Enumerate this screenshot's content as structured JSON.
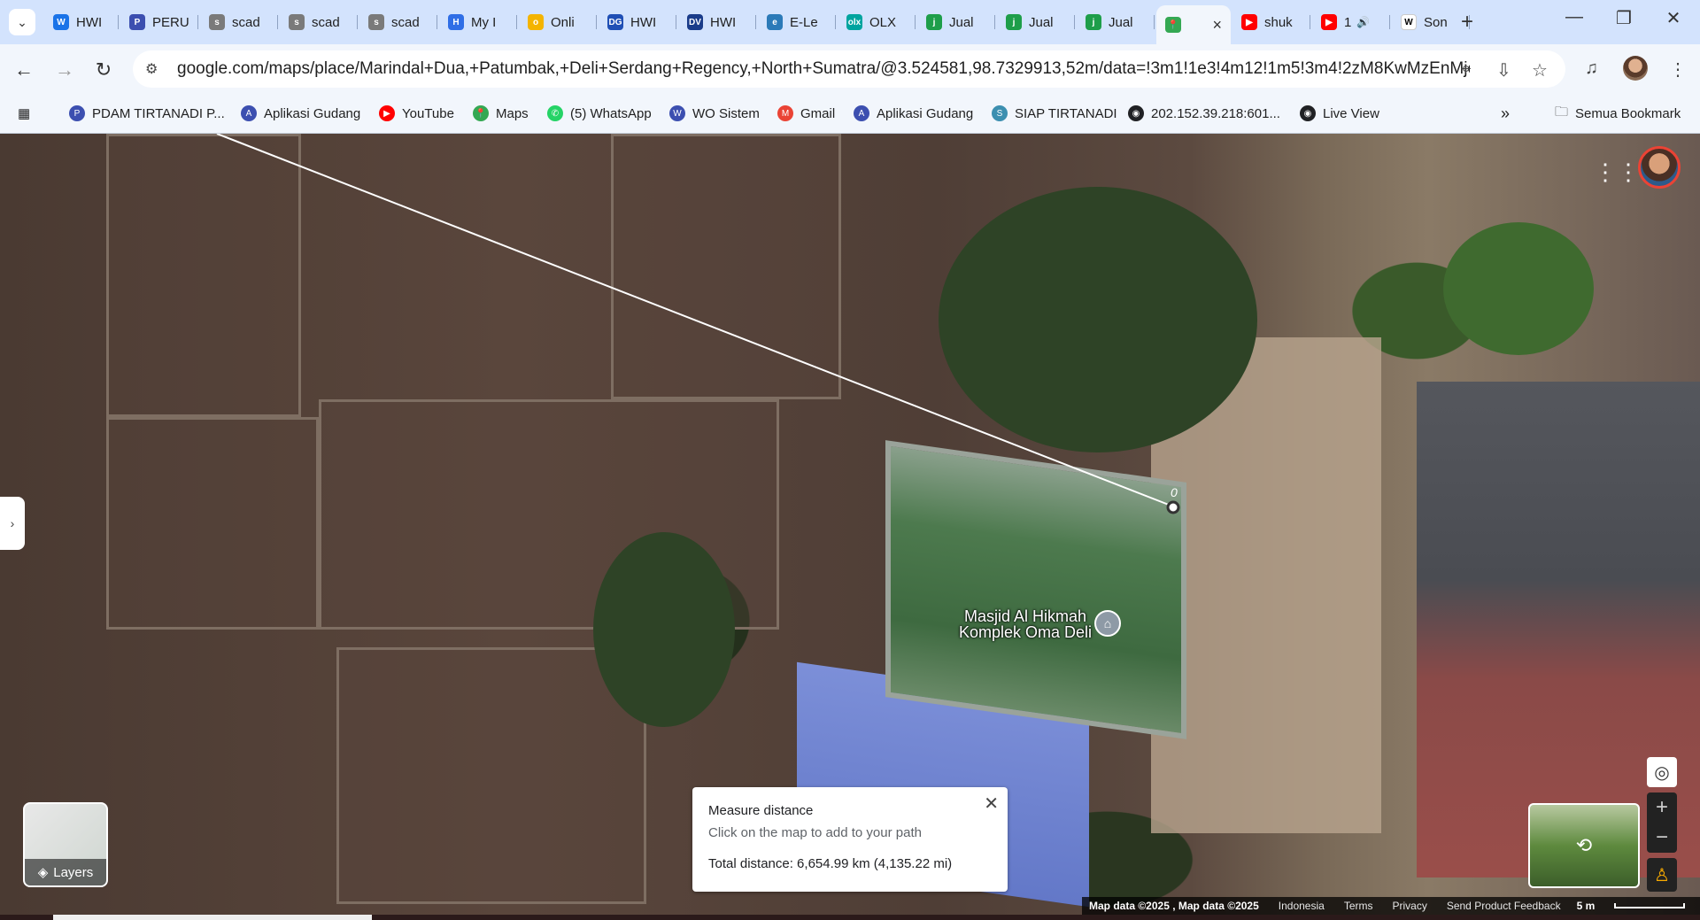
{
  "tabs": [
    {
      "label": "HWI",
      "fav_color": "#1a73e8",
      "fav_glyph": "W"
    },
    {
      "label": "PERU",
      "fav_color": "#3c4fb0",
      "fav_glyph": "P"
    },
    {
      "label": "scad",
      "fav_color": "#7a7a7a",
      "fav_glyph": "s"
    },
    {
      "label": "scad",
      "fav_color": "#7a7a7a",
      "fav_glyph": "s"
    },
    {
      "label": "scad",
      "fav_color": "#7a7a7a",
      "fav_glyph": "s"
    },
    {
      "label": "My I",
      "fav_color": "#2f6ee6",
      "fav_glyph": "H"
    },
    {
      "label": "Onli",
      "fav_color": "#f4b400",
      "fav_glyph": "o"
    },
    {
      "label": "HWI",
      "fav_color": "#1f4fb5",
      "fav_glyph": "DG"
    },
    {
      "label": "HWI",
      "fav_color": "#1a3c8a",
      "fav_glyph": "DV"
    },
    {
      "label": "E-Le",
      "fav_color": "#2b7ab8",
      "fav_glyph": "e"
    },
    {
      "label": "OLX",
      "fav_color": "#00a49f",
      "fav_glyph": "olx"
    },
    {
      "label": "Jual",
      "fav_color": "#1e9e4a",
      "fav_glyph": "j"
    },
    {
      "label": "Jual",
      "fav_color": "#1e9e4a",
      "fav_glyph": "j"
    },
    {
      "label": "Jual",
      "fav_color": "#1e9e4a",
      "fav_glyph": "j"
    },
    {
      "label": "",
      "fav_color": "#34a853",
      "fav_glyph": "📍",
      "active": true
    },
    {
      "label": "shuk",
      "fav_color": "#ff0000",
      "fav_glyph": "▶"
    },
    {
      "label": "1",
      "fav_color": "#ff0000",
      "fav_glyph": "▶",
      "audio": true
    },
    {
      "label": "Son",
      "fav_color": "#ffffff",
      "fav_glyph": "W"
    }
  ],
  "omnibox": {
    "url": "google.com/maps/place/Marindal+Dua,+Patumbak,+Deli+Serdang+Regency,+North+Sumatra/@3.524581,98.7329913,52m/data=!3m1!1e3!4m12!1m5!3m4!2zM8KwMzEnMjcuNCJOID..."
  },
  "bookmarks": [
    {
      "label": "PDAM TIRTANADI P...",
      "color": "#3c4fb0",
      "glyph": "P"
    },
    {
      "label": "Aplikasi Gudang",
      "color": "#3c4fb0",
      "glyph": "A"
    },
    {
      "label": "YouTube",
      "color": "#ff0000",
      "glyph": "▶"
    },
    {
      "label": "Maps",
      "color": "#34a853",
      "glyph": "📍"
    },
    {
      "label": "(5) WhatsApp",
      "color": "#25d366",
      "glyph": "✆"
    },
    {
      "label": "WO Sistem",
      "color": "#3c4fb0",
      "glyph": "W"
    },
    {
      "label": "Gmail",
      "color": "#ea4335",
      "glyph": "M"
    },
    {
      "label": "Aplikasi Gudang",
      "color": "#3c4fb0",
      "glyph": "A"
    },
    {
      "label": "SIAP TIRTANADI",
      "color": "#3c8fb0",
      "glyph": "S"
    },
    {
      "label": "202.152.39.218:601...",
      "color": "#202124",
      "glyph": "◉"
    },
    {
      "label": "Live View",
      "color": "#202124",
      "glyph": "◉"
    }
  ],
  "bookmarks_all": "Semua Bookmark",
  "map": {
    "poi_label_line1": "Masjid Al Hikmah",
    "poi_label_line2": "Komplek Oma Deli",
    "measure_point_label": "0",
    "layers_label": "Layers"
  },
  "measure": {
    "title": "Measure distance",
    "subtitle": "Click on the map to add to your path",
    "total": "Total distance: 6,654.99 km (4,135.22 mi)"
  },
  "footer": {
    "map_data": "Map data ©2025 , Map data ©2025",
    "region": "Indonesia",
    "terms": "Terms",
    "privacy": "Privacy",
    "feedback": "Send Product Feedback",
    "scale": "5 m"
  }
}
